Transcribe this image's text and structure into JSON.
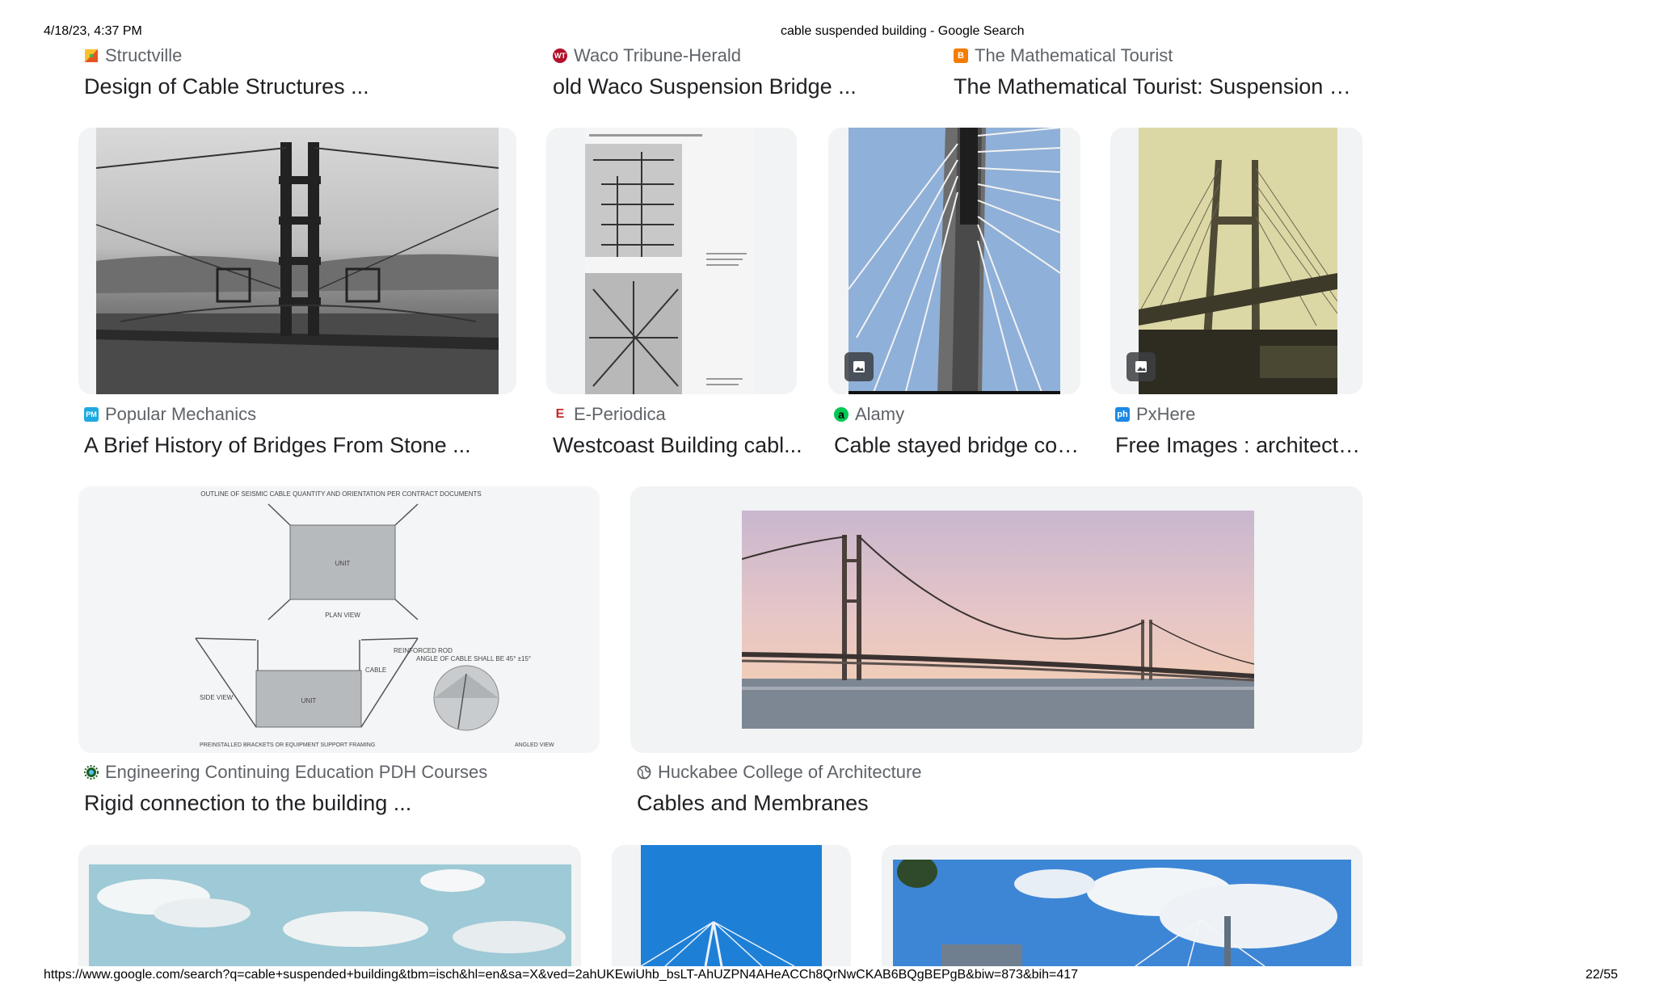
{
  "print_header": {
    "datetime": "4/18/23, 4:37 PM",
    "page_title": "cable suspended building - Google Search"
  },
  "print_footer": {
    "url": "https://www.google.com/search?q=cable+suspended+building&tbm=isch&hl=en&sa=X&ved=2ahUKEwiUhb_bsLT-AhUZPN4AHeACCh8QrNwCKAB6BQgBEPgB&biw=873&bih=417",
    "page_number": "22/55"
  },
  "results": [
    {
      "source": "Structville",
      "title": "Design of Cable Structures ...",
      "icon": "structville-favicon",
      "color": "#f28b25"
    },
    {
      "source": "Waco Tribune-Herald",
      "title": "old Waco Suspension Bridge ...",
      "icon": "waco-tribune-favicon",
      "favicon_text": "WT",
      "color": "#b3122a"
    },
    {
      "source": "The Mathematical Tourist",
      "title": "The Mathematical Tourist: Suspension R...",
      "icon": "blogger-favicon",
      "favicon_text": "B",
      "color": "#f57c00"
    },
    {
      "source": "Popular Mechanics",
      "title": "A Brief History of Bridges From Stone ...",
      "icon": "popular-mechanics-favicon",
      "favicon_text": "PM",
      "color": "#1fa9e1"
    },
    {
      "source": "E-Periodica",
      "title": "Westcoast Building cabl...",
      "icon": "e-periodica-favicon",
      "favicon_text": "E",
      "color": "#c62828"
    },
    {
      "source": "Alamy",
      "title": "Cable stayed bridge con...",
      "icon": "alamy-favicon",
      "favicon_text": "a",
      "color": "#00c853"
    },
    {
      "source": "PxHere",
      "title": "Free Images : architectu...",
      "icon": "pxhere-favicon",
      "favicon_text": "ph",
      "color": "#1e88e5"
    },
    {
      "source": "Engineering Continuing Education PDH Courses",
      "title": "Rigid connection to the building ...",
      "icon": "gear-favicon",
      "color": "#1b5e20"
    },
    {
      "source": "Huckabee College of Architecture",
      "title": "Cables and Membranes",
      "icon": "globe-icon",
      "color": "#5f6368"
    }
  ],
  "diagram_labels": {
    "top_note": "OUTLINE OF SEISMIC CABLE QUANTITY AND ORIENTATION PER CONTRACT DOCUMENTS",
    "unit": "UNIT",
    "plan_view": "PLAN VIEW",
    "reinforced_rod": "REINFORCED ROD",
    "cable": "CABLE",
    "angle_note": "ANGLE OF CABLE SHALL BE 45° ±15°",
    "side_view": "SIDE VIEW",
    "bottom_note": "PREINSTALLED BRACKETS OR EQUIPMENT SUPPORT FRAMING",
    "angled_view": "ANGLED VIEW"
  }
}
